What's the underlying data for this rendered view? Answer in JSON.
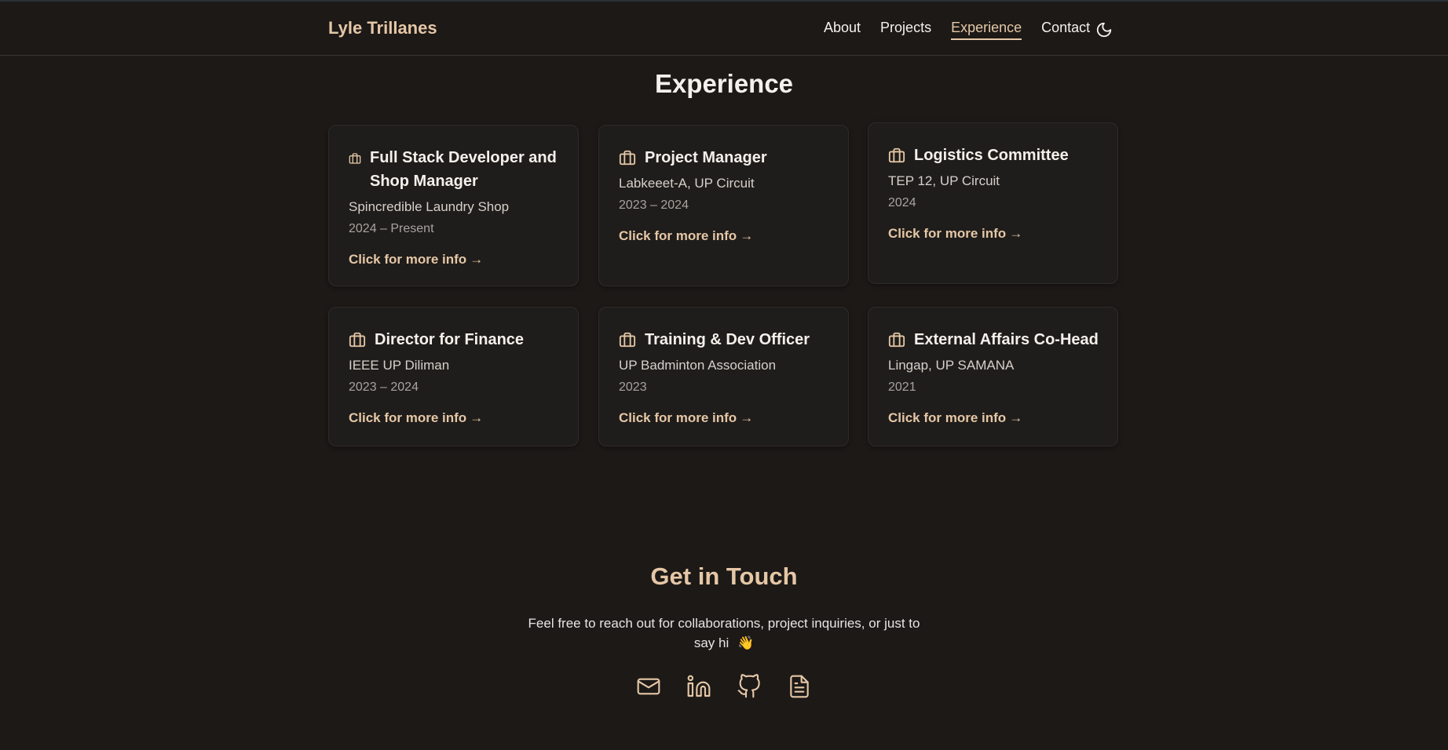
{
  "brand": "Lyle Trillanes",
  "nav": {
    "items": [
      "About",
      "Projects",
      "Experience",
      "Contact"
    ],
    "active": "Experience"
  },
  "experience": {
    "title": "Experience",
    "cards": [
      {
        "role": "Full Stack Developer and Shop Manager",
        "org": "Spincredible Laundry Shop",
        "dates": "2024 – Present",
        "link": "Click for more info"
      },
      {
        "role": "Project Manager",
        "org": "Labkeeet-A, UP Circuit",
        "dates": "2023 – 2024",
        "link": "Click for more info"
      },
      {
        "role": "Logistics Committee",
        "org": "TEP 12, UP Circuit",
        "dates": "2024",
        "link": "Click for more info"
      },
      {
        "role": "Director for Finance",
        "org": "IEEE UP Diliman",
        "dates": "2023 – 2024",
        "link": "Click for more info"
      },
      {
        "role": "Training & Dev Officer",
        "org": "UP Badminton Association",
        "dates": "2023",
        "link": "Click for more info"
      },
      {
        "role": "External Affairs Co-Head",
        "org": "Lingap, UP SAMANA",
        "dates": "2021",
        "link": "Click for more info"
      }
    ]
  },
  "contact": {
    "title": "Get in Touch",
    "text": "Feel free to reach out for collaborations, project inquiries, or just to say hi",
    "emoji": "👋",
    "icons": [
      "mail-icon",
      "linkedin-icon",
      "github-icon",
      "resume-icon"
    ]
  },
  "colors": {
    "background": "#1c1917",
    "card": "#1f1d1b",
    "accent": "#e5c7a6",
    "text": "#f5f0eb",
    "muted": "#a8a29e"
  }
}
